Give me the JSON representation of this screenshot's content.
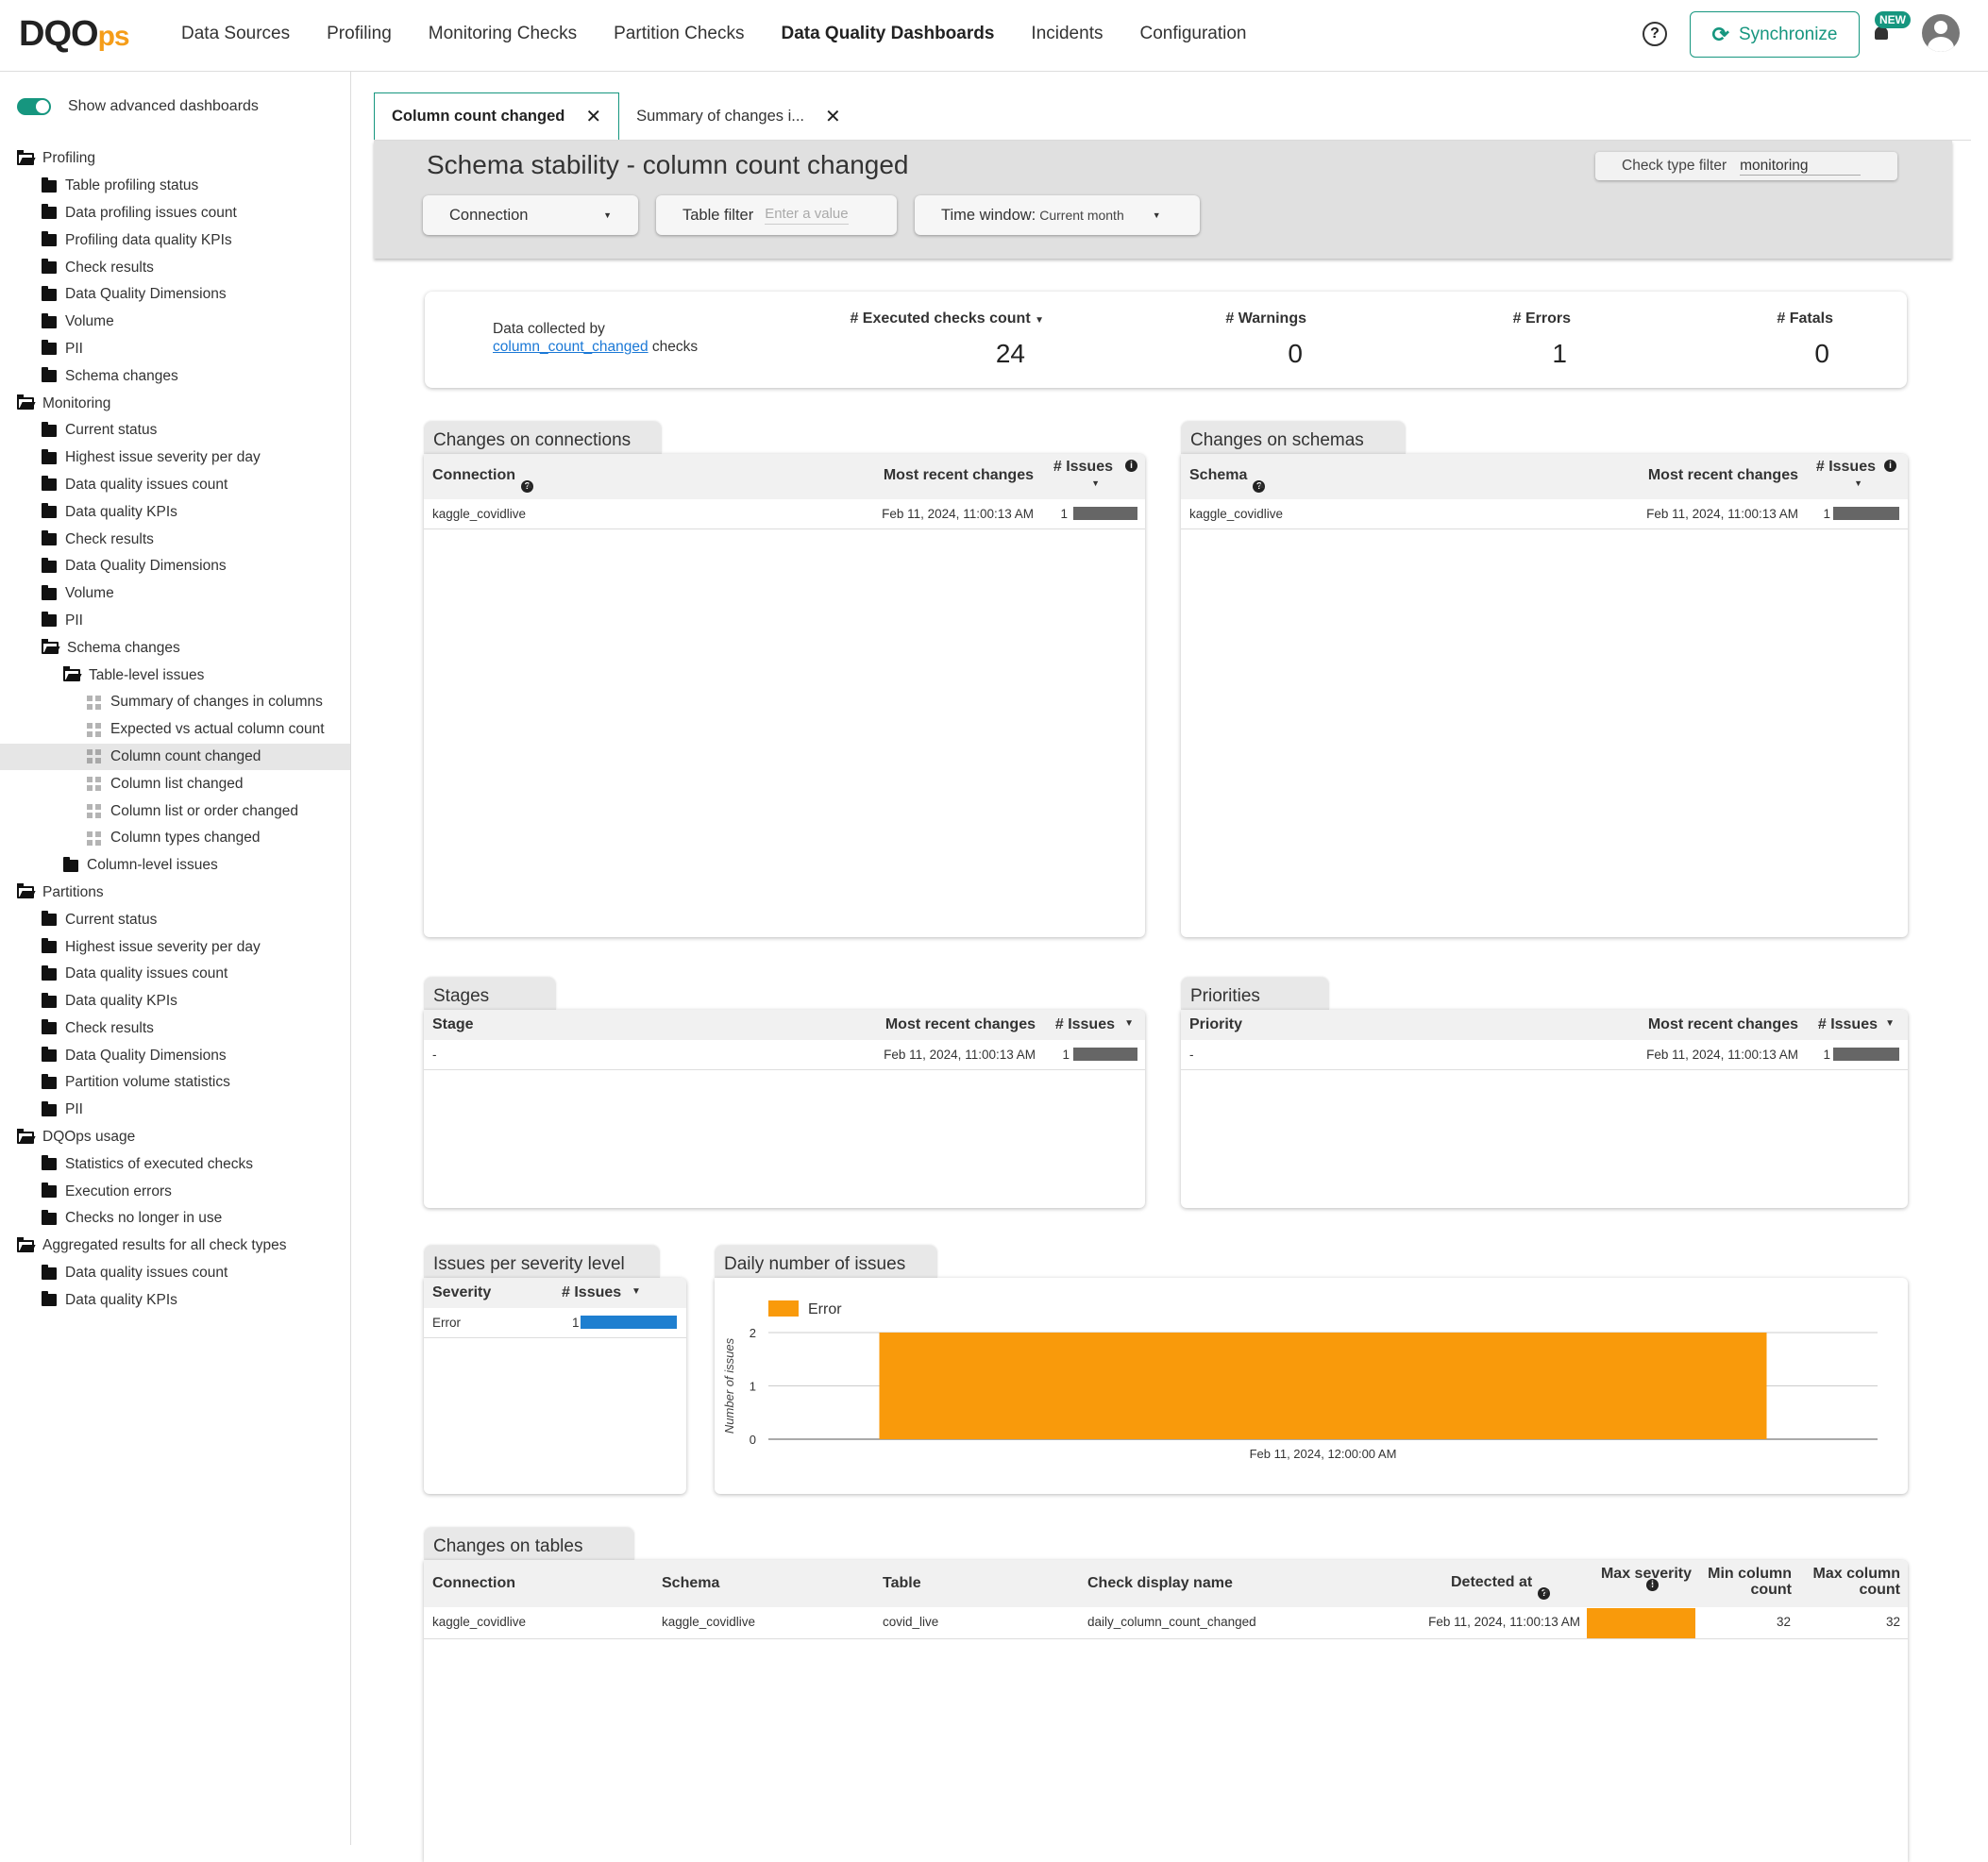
{
  "app": {
    "logo_main": "DQO",
    "logo_ps": "ps",
    "nav": [
      "Data Sources",
      "Profiling",
      "Monitoring Checks",
      "Partition Checks",
      "Data Quality Dashboards",
      "Incidents",
      "Configuration"
    ],
    "active_nav": "Data Quality Dashboards",
    "help_icon": "?",
    "sync_label": "Synchronize",
    "new_badge": "NEW",
    "accent_color": "#16967f"
  },
  "sidebar": {
    "toggle_label": "Show advanced dashboards",
    "tree": [
      {
        "label": "Profiling",
        "level": 0,
        "icon": "folder-open"
      },
      {
        "label": "Table profiling status",
        "level": 1,
        "icon": "folder"
      },
      {
        "label": "Data profiling issues count",
        "level": 1,
        "icon": "folder"
      },
      {
        "label": "Profiling data quality KPIs",
        "level": 1,
        "icon": "folder"
      },
      {
        "label": "Check results",
        "level": 1,
        "icon": "folder"
      },
      {
        "label": "Data Quality Dimensions",
        "level": 1,
        "icon": "folder"
      },
      {
        "label": "Volume",
        "level": 1,
        "icon": "folder"
      },
      {
        "label": "PII",
        "level": 1,
        "icon": "folder"
      },
      {
        "label": "Schema changes",
        "level": 1,
        "icon": "folder"
      },
      {
        "label": "Monitoring",
        "level": 0,
        "icon": "folder-open"
      },
      {
        "label": "Current status",
        "level": 1,
        "icon": "folder"
      },
      {
        "label": "Highest issue severity per day",
        "level": 1,
        "icon": "folder"
      },
      {
        "label": "Data quality issues count",
        "level": 1,
        "icon": "folder"
      },
      {
        "label": "Data quality KPIs",
        "level": 1,
        "icon": "folder"
      },
      {
        "label": "Check results",
        "level": 1,
        "icon": "folder"
      },
      {
        "label": "Data Quality Dimensions",
        "level": 1,
        "icon": "folder"
      },
      {
        "label": "Volume",
        "level": 1,
        "icon": "folder"
      },
      {
        "label": "PII",
        "level": 1,
        "icon": "folder"
      },
      {
        "label": "Schema changes",
        "level": 1,
        "icon": "folder-open"
      },
      {
        "label": "Table-level issues",
        "level": 2,
        "icon": "folder-open"
      },
      {
        "label": "Summary of changes in columns",
        "level": 3,
        "icon": "dashboard"
      },
      {
        "label": "Expected vs actual column count",
        "level": 3,
        "icon": "dashboard"
      },
      {
        "label": "Column count changed",
        "level": 3,
        "icon": "dashboard",
        "selected": true
      },
      {
        "label": "Column list changed",
        "level": 3,
        "icon": "dashboard"
      },
      {
        "label": "Column list or order changed",
        "level": 3,
        "icon": "dashboard"
      },
      {
        "label": "Column types changed",
        "level": 3,
        "icon": "dashboard"
      },
      {
        "label": "Column-level issues",
        "level": 2,
        "icon": "folder"
      },
      {
        "label": "Partitions",
        "level": 0,
        "icon": "folder-open"
      },
      {
        "label": "Current status",
        "level": 1,
        "icon": "folder"
      },
      {
        "label": "Highest issue severity per day",
        "level": 1,
        "icon": "folder"
      },
      {
        "label": "Data quality issues count",
        "level": 1,
        "icon": "folder"
      },
      {
        "label": "Data quality KPIs",
        "level": 1,
        "icon": "folder"
      },
      {
        "label": "Check results",
        "level": 1,
        "icon": "folder"
      },
      {
        "label": "Data Quality Dimensions",
        "level": 1,
        "icon": "folder"
      },
      {
        "label": "Partition volume statistics",
        "level": 1,
        "icon": "folder"
      },
      {
        "label": "PII",
        "level": 1,
        "icon": "folder"
      },
      {
        "label": "DQOps usage",
        "level": 0,
        "icon": "folder-open"
      },
      {
        "label": "Statistics of executed checks",
        "level": 1,
        "icon": "folder"
      },
      {
        "label": "Execution errors",
        "level": 1,
        "icon": "folder"
      },
      {
        "label": "Checks no longer in use",
        "level": 1,
        "icon": "folder"
      },
      {
        "label": "Aggregated results for all check types",
        "level": 0,
        "icon": "folder-open"
      },
      {
        "label": "Data quality issues count",
        "level": 1,
        "icon": "folder"
      },
      {
        "label": "Data quality KPIs",
        "level": 1,
        "icon": "folder"
      }
    ]
  },
  "tabs": [
    {
      "label": "Column count changed",
      "active": true
    },
    {
      "label": "Summary of changes i...",
      "active": false
    }
  ],
  "dashboard": {
    "title": "Schema stability - column count changed",
    "check_type_label": "Check type filter",
    "check_type_value": "monitoring",
    "connection_label": "Connection",
    "table_filter_label": "Table filter",
    "table_filter_placeholder": "Enter a value",
    "time_window_label": "Time window:",
    "time_window_value": "Current month"
  },
  "summary": {
    "note_prefix": "Data collected by",
    "note_link": "column_count_changed",
    "note_suffix": "checks",
    "executed_label": "# Executed checks count",
    "executed_value": "24",
    "warnings_label": "# Warnings",
    "warnings_value": "0",
    "errors_label": "# Errors",
    "errors_value": "1",
    "fatals_label": "# Fatals",
    "fatals_value": "0"
  },
  "connections": {
    "title": "Changes on connections",
    "col_name": "Connection",
    "col_recent": "Most recent changes",
    "col_issues": "# Issues",
    "rows": [
      {
        "name": "kaggle_covidlive",
        "recent": "Feb 11, 2024, 11:00:13 AM",
        "issues": "1",
        "fraction": 1.0
      }
    ]
  },
  "schemas": {
    "title": "Changes on schemas",
    "col_name": "Schema",
    "col_recent": "Most recent changes",
    "col_issues": "# Issues",
    "rows": [
      {
        "name": "kaggle_covidlive",
        "recent": "Feb 11, 2024, 11:00:13 AM",
        "issues": "1",
        "fraction": 1.0
      }
    ]
  },
  "stages": {
    "title": "Stages",
    "col_name": "Stage",
    "col_recent": "Most recent changes",
    "col_issues": "# Issues",
    "rows": [
      {
        "name": "-",
        "recent": "Feb 11, 2024, 11:00:13 AM",
        "issues": "1",
        "fraction": 1.0
      }
    ]
  },
  "priorities": {
    "title": "Priorities",
    "col_name": "Priority",
    "col_recent": "Most recent changes",
    "col_issues": "# Issues",
    "rows": [
      {
        "name": "-",
        "recent": "Feb 11, 2024, 11:00:13 AM",
        "issues": "1",
        "fraction": 1.0
      }
    ]
  },
  "severity": {
    "title": "Issues per severity level",
    "col_severity": "Severity",
    "col_issues": "# Issues",
    "rows": [
      {
        "name": "Error",
        "issues": "1",
        "fraction": 1.0,
        "color": "#1e7fd0"
      }
    ]
  },
  "daily": {
    "title": "Daily number of issues"
  },
  "chart_data": {
    "type": "bar",
    "categories": [
      "Feb 11, 2024, 12:00:00 AM"
    ],
    "series": [
      {
        "name": "Error",
        "values": [
          2
        ],
        "color": "#f99a0b"
      }
    ],
    "xlabel": "",
    "ylabel": "Number of issues",
    "yticks": [
      0,
      1,
      2
    ],
    "ylim": [
      0,
      2
    ],
    "legend": "top-left",
    "grid": true
  },
  "tables": {
    "title": "Changes on tables",
    "headers": [
      "Connection",
      "Schema",
      "Table",
      "Check display name",
      "Detected at",
      "Max severity",
      "Min column count",
      "Max column count"
    ],
    "max_severity_color": "#f99a0b",
    "rows": [
      {
        "connection": "kaggle_covidlive",
        "schema": "kaggle_covidlive",
        "table": "covid_live",
        "check": "daily_column_count_changed",
        "detected": "Feb 11, 2024, 11:00:13 AM",
        "min": "32",
        "max": "32"
      }
    ]
  }
}
